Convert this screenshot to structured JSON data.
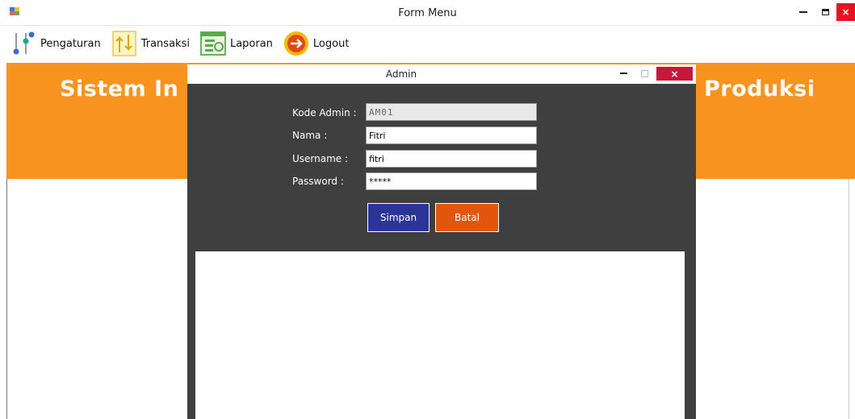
{
  "window": {
    "title": "Form Menu"
  },
  "menu": {
    "items": [
      {
        "label": "Pengaturan",
        "icon": "settings-sliders-icon"
      },
      {
        "label": "Transaksi",
        "icon": "transfer-arrows-icon"
      },
      {
        "label": "Laporan",
        "icon": "report-window-icon"
      },
      {
        "label": "Logout",
        "icon": "logout-arrow-icon"
      }
    ]
  },
  "header": {
    "title_left": "Sistem In",
    "title_right": "Produksi"
  },
  "dialog": {
    "title": "Admin",
    "close_label": "×",
    "fields": {
      "kode_label": "Kode Admin :",
      "kode_value": "AM01",
      "nama_label": "Nama :",
      "nama_value": "Fitri",
      "username_label": "Username :",
      "username_value": "fitri",
      "password_label": "Password :",
      "password_value": "*****"
    },
    "buttons": {
      "save_label": "Simpan",
      "cancel_label": "Batal"
    }
  },
  "colors": {
    "header_orange": "#f7931e",
    "dialog_dark": "#3f3f3f",
    "save_blue": "#2b3595",
    "cancel_orange": "#e2550c",
    "close_red": "#e81123"
  }
}
